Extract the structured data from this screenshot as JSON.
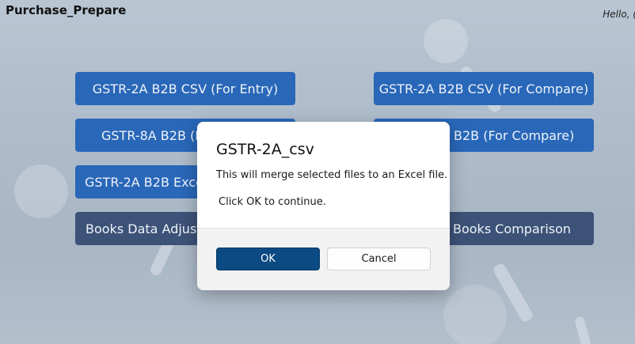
{
  "app": {
    "title": "Purchase_Prepare",
    "greeting": "Hello, ("
  },
  "buttons": [
    {
      "id": "gstr2a-b2b-csv-entry",
      "label": "GSTR-2A B2B CSV (For Entry)"
    },
    {
      "id": "gstr2a-b2b-csv-compare",
      "label": "GSTR-2A B2B CSV (For Compare)"
    },
    {
      "id": "gstr8a-b2b-entry",
      "label": "GSTR-8A B2B (Fo"
    },
    {
      "id": "gstr8a-b2b-compare",
      "label": "B2B (For Compare)"
    },
    {
      "id": "gstr2a-b2b-excel",
      "label": "GSTR-2A B2B Excel"
    },
    {
      "id": "books-data-adjust",
      "label": "Books Data Adjust"
    },
    {
      "id": "books-comparison",
      "label": "Books Comparison"
    }
  ],
  "dialog": {
    "title": "GSTR-2A_csv",
    "message_line1": "This will merge selected files to an Excel file.",
    "message_line2": "Click OK to continue.",
    "ok_label": "OK",
    "cancel_label": "Cancel"
  },
  "colors": {
    "primary_button": "#2967b8",
    "secondary_button": "#3d5277",
    "ok_button": "#0b4a82"
  }
}
